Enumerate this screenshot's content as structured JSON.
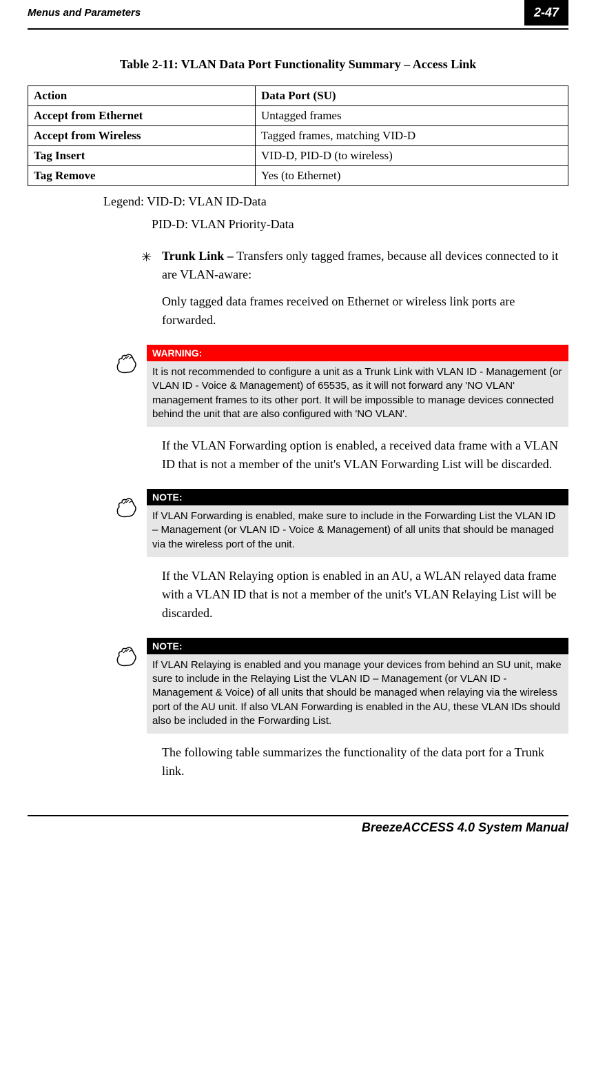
{
  "header": {
    "section": "Menus and Parameters",
    "pageNum": "2-47"
  },
  "table": {
    "title": "Table 2-11: VLAN Data Port Functionality Summary – Access Link",
    "headers": [
      "Action",
      "Data Port (SU)"
    ],
    "rows": [
      [
        "Accept from Ethernet",
        "Untagged frames"
      ],
      [
        "Accept from Wireless",
        "Tagged frames, matching VID-D"
      ],
      [
        "Tag Insert",
        "VID-D, PID-D (to wireless)"
      ],
      [
        "Tag Remove",
        "Yes (to Ethernet)"
      ]
    ]
  },
  "legend": {
    "line1": "Legend: VID-D: VLAN ID-Data",
    "line2": "PID-D: VLAN Priority-Data"
  },
  "bullet": {
    "star": "✳",
    "lead": "Trunk Link – ",
    "tail": "Transfers only tagged frames, because all devices connected to it are VLAN-aware:",
    "para2": "Only tagged data frames received on Ethernet or wireless link ports are forwarded."
  },
  "warning": {
    "label": "WARNING:",
    "text": "It is not recommended to configure a unit as a Trunk Link with VLAN ID - Management (or VLAN ID - Voice & Management) of 65535, as it will not forward any 'NO VLAN' management frames to its other port. It will be impossible to manage devices connected behind the unit that are also configured with 'NO VLAN'."
  },
  "para_forwarding": "If the VLAN Forwarding option is enabled, a received data frame with a VLAN ID that is not a member of the unit's VLAN Forwarding List will be discarded.",
  "note1": {
    "label": "NOTE:",
    "text": "If VLAN Forwarding is enabled, make sure to include in the Forwarding List the VLAN ID – Management (or VLAN ID - Voice & Management) of all units that should be managed via the wireless port of the unit."
  },
  "para_relaying": "If the VLAN Relaying option is enabled in an AU, a WLAN relayed data frame with a VLAN ID that is not a member of the unit's VLAN Relaying List will be discarded.",
  "note2": {
    "label": "NOTE:",
    "text": "If VLAN Relaying is enabled and you manage your devices from behind an SU unit, make sure to include in the Relaying List the VLAN ID – Management (or VLAN ID - Management & Voice) of all units that should be managed when relaying via the wireless port of the AU unit. If also VLAN Forwarding is enabled in the AU, these VLAN IDs should also be included in the Forwarding List."
  },
  "para_summary": "The following table summarizes the functionality of the data port for a Trunk link.",
  "footer": "BreezeACCESS 4.0 System Manual"
}
